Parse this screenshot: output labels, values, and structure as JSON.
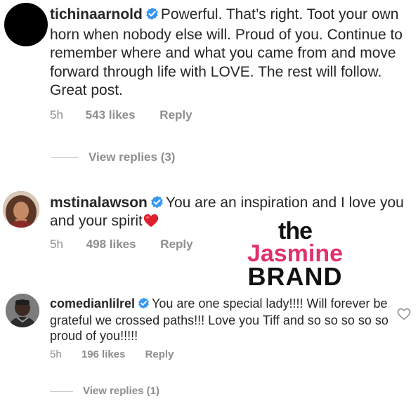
{
  "comments": [
    {
      "username": "tichinaarnold",
      "verified": true,
      "text": "Powerful.  That’s right. Toot your own horn when nobody else will. Proud of you. Continue to remember where and what you came from and move forward through life with LOVE. The rest will follow. Great post.",
      "time": "5h",
      "likes": "543 likes",
      "reply_label": "Reply",
      "view_replies": "View replies (3)"
    },
    {
      "username": "mstinalawson",
      "verified": true,
      "text": "You are an inspiration and I love you and your spirit",
      "emoji": "red-heart",
      "time": "5h",
      "likes": "498 likes",
      "reply_label": "Reply"
    },
    {
      "username": "comedianlilrel",
      "verified": true,
      "text": "You are one special lady!!!! Will forever be grateful we crossed paths!!! Love you Tiff and so so so so so proud of you!!!!!",
      "time": "5h",
      "likes": "196 likes",
      "reply_label": "Reply",
      "view_replies": "View replies (1)"
    }
  ],
  "watermark": {
    "line1": "the",
    "line2": "Jasmine",
    "line3": "BRAND"
  },
  "colors": {
    "text": "#262626",
    "muted": "#8e8e8e",
    "verified": "#3897f0",
    "heart": "#ed4956",
    "watermark_pink": "#e0306e"
  }
}
